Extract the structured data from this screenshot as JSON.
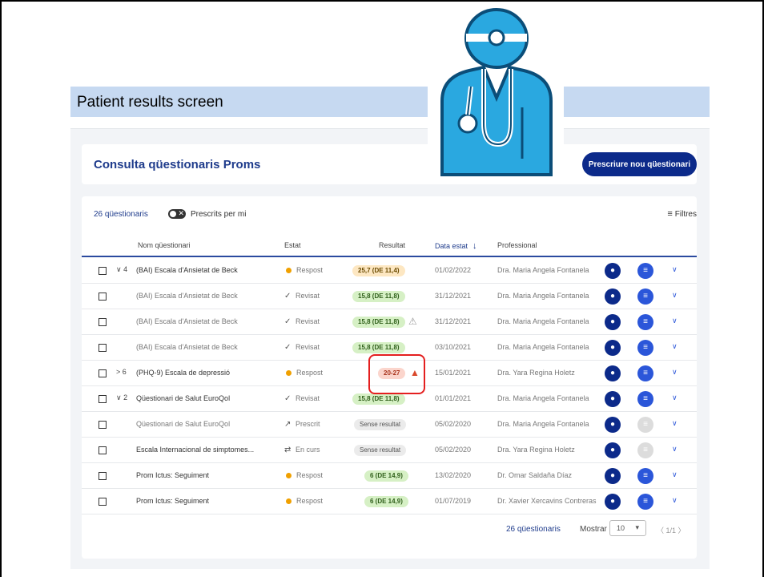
{
  "banner": {
    "title": "Patient results screen"
  },
  "header": {
    "title": "Consulta qüestionaris Proms",
    "prescribe_label": "Prescriure nou qüestionari"
  },
  "toolbar": {
    "count": "26 qüestionaris",
    "toggle_label": "Prescrits per mi",
    "filters_label": "Filtres"
  },
  "columns": {
    "name": "Nom qüestionari",
    "status": "Estat",
    "result": "Resultat",
    "date": "Data estat",
    "professional": "Professional"
  },
  "rows": [
    {
      "expander": "∨ 4",
      "name": "(BAI) Escala d'Ansietat de Beck",
      "status": "Respost",
      "result": "25,7 (DE 11,4)",
      "date": "01/02/2022",
      "professional": "Dra. Maria Angela Fontanela"
    },
    {
      "name": "(BAI) Escala d'Ansietat de Beck",
      "status": "Revisat",
      "result": "15,8 (DE 11,8)",
      "date": "31/12/2021",
      "professional": "Dra. Maria Angela Fontanela"
    },
    {
      "name": "(BAI) Escala d'Ansietat de Beck",
      "status": "Revisat",
      "result": "15,8 (DE 11,8)",
      "date": "31/12/2021",
      "professional": "Dra. Maria Angela Fontanela"
    },
    {
      "name": "(BAI) Escala d'Ansietat de Beck",
      "status": "Revisat",
      "result": "15,8 (DE 11,8)",
      "date": "03/10/2021",
      "professional": "Dra. Maria Angela Fontanela"
    },
    {
      "expander": "> 6",
      "name": "(PHQ-9) Escala de depressió",
      "status": "Respost",
      "result": "20-27",
      "date": "15/01/2021",
      "professional": "Dra. Yara Regina Holetz"
    },
    {
      "expander": "∨ 2",
      "name": "Qüestionari de Salut EuroQol",
      "status": "Revisat",
      "result": "15,8 (DE 11,8)",
      "date": "01/01/2021",
      "professional": "Dra. Maria Angela Fontanela"
    },
    {
      "name": "Qüestionari de Salut EuroQol",
      "status": "Prescrit",
      "result": "Sense resultat",
      "date": "05/02/2020",
      "professional": "Dra. Maria Angela Fontanela"
    },
    {
      "name": "Escala Internacional de simptomes...",
      "status": "En curs",
      "result": "Sense resultat",
      "date": "05/02/2020",
      "professional": "Dra. Yara Regina Holetz"
    },
    {
      "name": "Prom Ictus: Seguiment",
      "status": "Respost",
      "result": "6 (DE 14,9)",
      "date": "13/02/2020",
      "professional": "Dr. Omar Saldaña Díaz"
    },
    {
      "name": "Prom Ictus: Seguiment",
      "status": "Respost",
      "result": "6 (DE 14,9)",
      "date": "01/07/2019",
      "professional": "Dr. Xavier Xercavins Contreras"
    }
  ],
  "footer": {
    "count": "26 qüestionaris",
    "show_label": "Mostrar",
    "page_size": "10",
    "pages": "〈 1/1 〉"
  },
  "colors": {
    "primary": "#0c2a8a",
    "accent": "#2b56d9",
    "banner": "#c6d9f1",
    "highlight": "#e41f1f"
  }
}
